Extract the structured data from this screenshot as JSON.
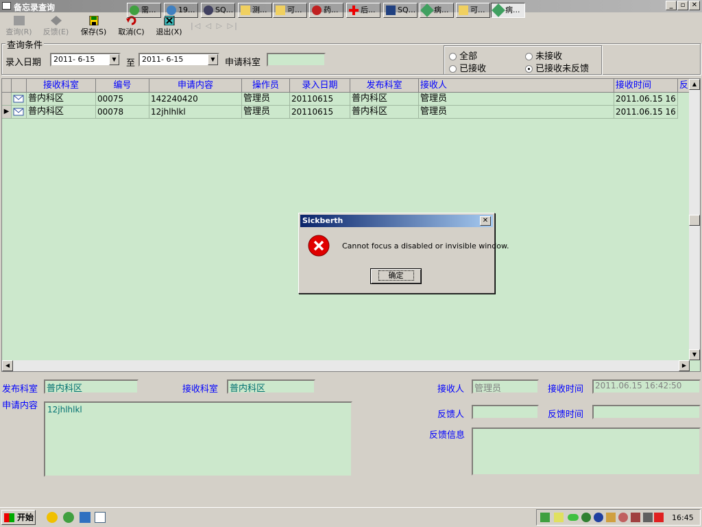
{
  "window": {
    "title": "备忘录查询",
    "min": "_",
    "max": "▫",
    "close": "✕"
  },
  "toolbar": {
    "query": "查询(R)",
    "feedback": "反馈(E)",
    "save": "保存(S)",
    "cancel": "取消(C)",
    "exit": "退出(X)",
    "nav": [
      "|◁",
      "◁",
      "▷",
      "▷|"
    ]
  },
  "query": {
    "group_title": "查询条件",
    "date_label": "录入日期",
    "date_from": "2011- 6-15",
    "to_label": "至",
    "date_to": "2011- 6-15",
    "dept_label": "申请科室",
    "dept_value": "",
    "radio": [
      {
        "label": "全部",
        "checked": false
      },
      {
        "label": "未接收",
        "checked": false
      },
      {
        "label": "已接收",
        "checked": false
      },
      {
        "label": "已接收未反馈",
        "checked": true
      }
    ]
  },
  "grid": {
    "headers": [
      "接收科室",
      "编号",
      "申请内容",
      "操作员",
      "录入日期",
      "发布科室",
      "接收人",
      "接收时间",
      "反"
    ],
    "rows": [
      {
        "cells": [
          "普内科区",
          "00075",
          "142240420",
          "管理员",
          "20110615",
          "普内科区",
          "管理员",
          "2011.06.15 16"
        ],
        "current": false
      },
      {
        "cells": [
          "普内科区",
          "00078",
          "12jhlhlkl",
          "管理员",
          "20110615",
          "普内科区",
          "管理员",
          "2011.06.15 16"
        ],
        "current": true
      }
    ]
  },
  "detail": {
    "pub_dept_label": "发布科室",
    "pub_dept": "普内科区",
    "recv_dept_label": "接收科室",
    "recv_dept": "普内科区",
    "receiver_label": "接收人",
    "receiver": "管理员",
    "recv_time_label": "接收时间",
    "recv_time": "2011.06.15 16:42:50",
    "content_label": "申请内容",
    "content": "12jhlhlkl",
    "feedback_person_label": "反馈人",
    "feedback_person": "",
    "feedback_time_label": "反馈时间",
    "feedback_time": "",
    "feedback_info_label": "反馈信息",
    "feedback_info": ""
  },
  "dialog": {
    "title": "Sickberth",
    "message": "Cannot focus a disabled or invisible window.",
    "ok": "确定"
  },
  "taskbar": {
    "start": "开始",
    "items": [
      "需...",
      "19...",
      "SQ...",
      "测...",
      "可...",
      "药...",
      "后...",
      "SQ...",
      "病...",
      "可...",
      "病..."
    ],
    "clock": "16:45"
  }
}
